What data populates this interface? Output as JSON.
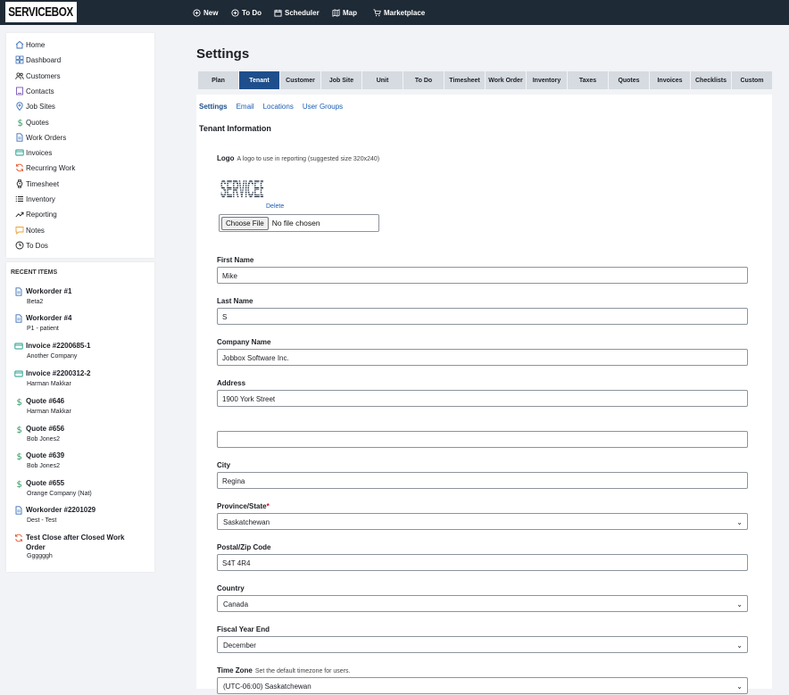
{
  "app": {
    "logo_text": "SERVICEBOX"
  },
  "topnav": [
    {
      "label": "New",
      "icon": "plus-circle-icon"
    },
    {
      "label": "To Do",
      "icon": "plus-circle-icon"
    },
    {
      "label": "Scheduler",
      "icon": "calendar-icon"
    },
    {
      "label": "Map",
      "icon": "map-icon"
    },
    {
      "label": "Marketplace",
      "icon": "cart-icon"
    }
  ],
  "sidebar": {
    "items": [
      {
        "label": "Home",
        "icon": "home-icon"
      },
      {
        "label": "Dashboard",
        "icon": "dashboard-icon"
      },
      {
        "label": "Customers",
        "icon": "users-icon"
      },
      {
        "label": "Contacts",
        "icon": "contacts-icon"
      },
      {
        "label": "Job Sites",
        "icon": "location-pin-icon"
      },
      {
        "label": "Quotes",
        "icon": "dollar-icon"
      },
      {
        "label": "Work Orders",
        "icon": "document-icon"
      },
      {
        "label": "Invoices",
        "icon": "invoice-icon"
      },
      {
        "label": "Recurring Work",
        "icon": "refresh-icon"
      },
      {
        "label": "Timesheet",
        "icon": "watch-icon"
      },
      {
        "label": "Inventory",
        "icon": "list-icon"
      },
      {
        "label": "Reporting",
        "icon": "trend-icon"
      },
      {
        "label": "Notes",
        "icon": "note-icon"
      },
      {
        "label": "To Dos",
        "icon": "clock-icon"
      }
    ]
  },
  "recent": {
    "title": "RECENT ITEMS",
    "items": [
      {
        "title": "Workorder #1",
        "sub": "Beta2",
        "icon": "document-icon"
      },
      {
        "title": "Workorder #4",
        "sub": "P1 - patient",
        "icon": "document-icon"
      },
      {
        "title": "Invoice #2200685-1",
        "sub": "Another Company",
        "icon": "invoice-icon"
      },
      {
        "title": "Invoice #2200312-2",
        "sub": "Harman Makkar",
        "icon": "invoice-icon"
      },
      {
        "title": "Quote #646",
        "sub": "Harman Makkar",
        "icon": "dollar-icon"
      },
      {
        "title": "Quote #656",
        "sub": "Bob Jones2",
        "icon": "dollar-icon"
      },
      {
        "title": "Quote #639",
        "sub": "Bob Jones2",
        "icon": "dollar-icon"
      },
      {
        "title": "Quote #655",
        "sub": "Orange Company (Nat)",
        "icon": "dollar-icon"
      },
      {
        "title": "Workorder #2201029",
        "sub": "Dest - Test",
        "icon": "document-icon"
      },
      {
        "title": "Test Close after Closed Work Order",
        "sub": "Ggggggh",
        "icon": "refresh-icon"
      }
    ]
  },
  "page": {
    "title": "Settings"
  },
  "tabs": [
    "Plan",
    "Tenant",
    "Customer",
    "Job Site",
    "Unit",
    "To Do",
    "Timesheet",
    "Work Order",
    "Inventory",
    "Taxes",
    "Quotes",
    "Invoices",
    "Checklists",
    "Custom"
  ],
  "active_tab": "Tenant",
  "subtabs": [
    "Settings",
    "Email",
    "Locations",
    "User Groups"
  ],
  "active_subtab": "Settings",
  "section": {
    "title": "Tenant Information"
  },
  "logo_field": {
    "label": "Logo",
    "hint": "A logo to use in reporting (suggested size 320x240)",
    "delete_label": "Delete",
    "file_button": "Choose File",
    "file_status": "No file chosen"
  },
  "form": {
    "first_name": {
      "label": "First Name",
      "value": "Mike"
    },
    "last_name": {
      "label": "Last Name",
      "value": "S"
    },
    "company_name": {
      "label": "Company Name",
      "value": "Jobbox Software Inc."
    },
    "address": {
      "label": "Address",
      "value": "1900 York Street"
    },
    "address2": {
      "label": "",
      "value": ""
    },
    "city": {
      "label": "City",
      "value": "Regina"
    },
    "province": {
      "label": "Province/State",
      "required": "*",
      "value": "Saskatchewan"
    },
    "postal": {
      "label": "Postal/Zip Code",
      "value": "S4T 4R4"
    },
    "country": {
      "label": "Country",
      "value": "Canada"
    },
    "fiscal": {
      "label": "Fiscal Year End",
      "value": "December"
    },
    "timezone": {
      "label": "Time Zone",
      "hint": "Set the default timezone for users.",
      "value": "(UTC-06:00) Saskatchewan"
    }
  }
}
